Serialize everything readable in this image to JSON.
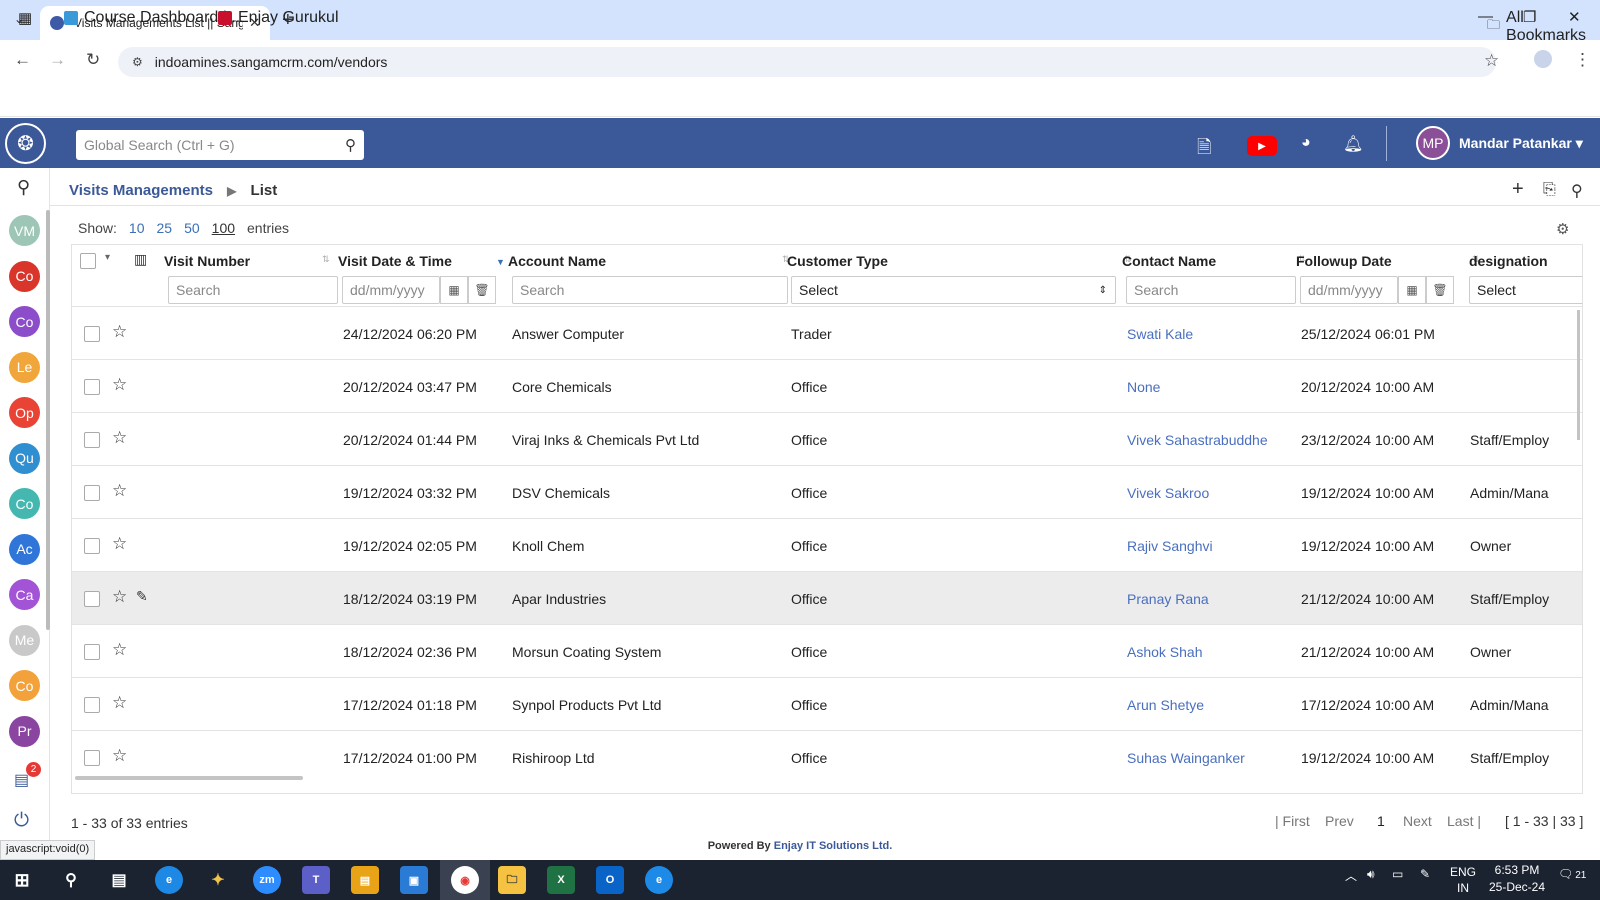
{
  "browser": {
    "tab_title": "Visits Managements List || Sang",
    "url": "indoamines.sangamcrm.com/vendors",
    "bookmarks": [
      "Course Dashboard |...",
      "Enjay Gurukul"
    ],
    "all_bookmarks": "All Bookmarks"
  },
  "header": {
    "global_search_placeholder": "Global Search (Ctrl + G)",
    "user_initials": "MP",
    "user_name": "Mandar Patankar",
    "colors": {
      "bar": "#3b5998"
    }
  },
  "rail": {
    "items": [
      {
        "label": "VM",
        "color": "#9dc6b6"
      },
      {
        "label": "Co",
        "color": "#d9352b"
      },
      {
        "label": "Co",
        "color": "#8b4dc9"
      },
      {
        "label": "Le",
        "color": "#f0a63a"
      },
      {
        "label": "Op",
        "color": "#e94335"
      },
      {
        "label": "Qu",
        "color": "#2f8fd0"
      },
      {
        "label": "Co",
        "color": "#44b8b0"
      },
      {
        "label": "Ac",
        "color": "#2f76d8"
      },
      {
        "label": "Ca",
        "color": "#a253d6"
      },
      {
        "label": "Me",
        "color": "#c9c9c9"
      },
      {
        "label": "Co",
        "color": "#f3a23b"
      },
      {
        "label": "Pr",
        "color": "#8a45a0"
      }
    ],
    "badge": "2"
  },
  "breadcrumb": {
    "module": "Visits Managements",
    "page": "List"
  },
  "show": {
    "label": "Show:",
    "options": [
      "10",
      "25",
      "50",
      "100"
    ],
    "suffix": "entries"
  },
  "table": {
    "columns": [
      "Visit Number",
      "Visit Date & Time",
      "Account Name",
      "Customer Type",
      "Contact Name",
      "Followup Date",
      "designation"
    ],
    "filters": {
      "visit_number": "Search",
      "visit_date": "dd/mm/yyyy",
      "account": "Search",
      "customer_type": "Select",
      "contact": "Search",
      "followup": "dd/mm/yyyy",
      "designation": "Select"
    },
    "rows": [
      {
        "date": "24/12/2024 06:20 PM",
        "account": "Answer Computer",
        "type": "Trader",
        "contact": "Swati Kale",
        "followup": "25/12/2024 06:01 PM",
        "designation": ""
      },
      {
        "date": "20/12/2024 03:47 PM",
        "account": "Core Chemicals",
        "type": "Office",
        "contact": "None",
        "followup": "20/12/2024 10:00 AM",
        "designation": ""
      },
      {
        "date": "20/12/2024 01:44 PM",
        "account": "Viraj Inks & Chemicals Pvt Ltd",
        "type": "Office",
        "contact": "Vivek Sahastrabuddhe",
        "followup": "23/12/2024 10:00 AM",
        "designation": "Staff/Employ"
      },
      {
        "date": "19/12/2024 03:32 PM",
        "account": "DSV Chemicals",
        "type": "Office",
        "contact": "Vivek Sakroo",
        "followup": "19/12/2024 10:00 AM",
        "designation": "Admin/Mana"
      },
      {
        "date": "19/12/2024 02:05 PM",
        "account": "Knoll Chem",
        "type": "Office",
        "contact": "Rajiv Sanghvi",
        "followup": "19/12/2024 10:00 AM",
        "designation": "Owner"
      },
      {
        "date": "18/12/2024 03:19 PM",
        "account": "Apar Industries",
        "type": "Office",
        "contact": "Pranay Rana",
        "followup": "21/12/2024 10:00 AM",
        "designation": "Staff/Employ"
      },
      {
        "date": "18/12/2024 02:36 PM",
        "account": "Morsun Coating System",
        "type": "Office",
        "contact": "Ashok Shah",
        "followup": "21/12/2024 10:00 AM",
        "designation": "Owner"
      },
      {
        "date": "17/12/2024 01:18 PM",
        "account": "Synpol Products Pvt Ltd",
        "type": "Office",
        "contact": "Arun Shetye",
        "followup": "17/12/2024 10:00 AM",
        "designation": "Admin/Mana"
      },
      {
        "date": "17/12/2024 01:00 PM",
        "account": "Rishiroop Ltd",
        "type": "Office",
        "contact": "Suhas Wainganker",
        "followup": "19/12/2024 10:00 AM",
        "designation": "Staff/Employ"
      }
    ]
  },
  "footer": {
    "entries_info": "1 - 33 of 33 entries",
    "first": "| First",
    "prev": "Prev",
    "page": "1",
    "next": "Next",
    "last": "Last |",
    "range": "[ 1 - 33 | 33 ]",
    "powered_prefix": "Powered By",
    "powered_company": "Enjay IT Solutions Ltd.",
    "status_url": "javascript:void(0)"
  },
  "taskbar": {
    "lang": "ENG",
    "region": "IN",
    "time": "6:53 PM",
    "date": "25-Dec-24",
    "notif_count": "21"
  }
}
